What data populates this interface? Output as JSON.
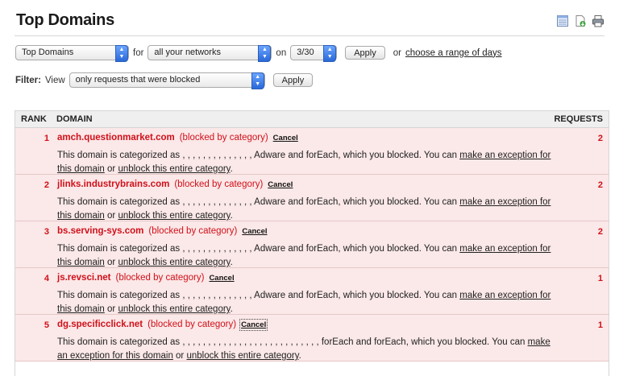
{
  "page": {
    "title": "Top Domains"
  },
  "header_icons": [
    "table-view-icon",
    "export-icon",
    "print-icon"
  ],
  "controls": {
    "report_select": "Top Domains",
    "for_label": "for",
    "network_select": "all your networks",
    "on_label": "on",
    "date_select": "3/30",
    "apply_label": "Apply",
    "or_label": "or",
    "range_link": "choose a range of days"
  },
  "filter": {
    "label": "Filter:",
    "view_label": "View",
    "select": "only requests that were blocked",
    "apply_label": "Apply"
  },
  "table": {
    "headers": {
      "rank": "RANK",
      "domain": "DOMAIN",
      "requests": "REQUESTS"
    },
    "rows": [
      {
        "rank": "1",
        "domain": "amch.questionmarket.com",
        "status": "(blocked by category)",
        "cancel": "Cancel",
        "desc_pre": "This domain is categorized as , , , , , , , , , , , , , , Adware and forEach, which you blocked.  You can ",
        "exception_link": "make an exception for this domain",
        "or": " or ",
        "unblock_link": "unblock this entire category",
        "end": ".",
        "requests": "2"
      },
      {
        "rank": "2",
        "domain": "jlinks.industrybrains.com",
        "status": "(blocked by category)",
        "cancel": "Cancel",
        "desc_pre": "This domain is categorized as , , , , , , , , , , , , , , Adware and forEach, which you blocked.  You can ",
        "exception_link": "make an exception for this domain",
        "or": " or ",
        "unblock_link": "unblock this entire category",
        "end": ".",
        "requests": "2"
      },
      {
        "rank": "3",
        "domain": "bs.serving-sys.com",
        "status": "(blocked by category)",
        "cancel": "Cancel",
        "desc_pre": "This domain is categorized as , , , , , , , , , , , , , , Adware and forEach, which you blocked.  You can ",
        "exception_link": "make an exception for this domain",
        "or": " or ",
        "unblock_link": "unblock this entire category",
        "end": ".",
        "requests": "2"
      },
      {
        "rank": "4",
        "domain": "js.revsci.net",
        "status": "(blocked by category)",
        "cancel": "Cancel",
        "desc_pre": "This domain is categorized as , , , , , , , , , , , , , , Adware and forEach, which you blocked.  You can ",
        "exception_link": "make an exception for this domain",
        "or": " or ",
        "unblock_link": "unblock this entire category",
        "end": ".",
        "requests": "1"
      },
      {
        "rank": "5",
        "domain": "dg.specificclick.net",
        "status": "(blocked by category)",
        "cancel": "Cancel",
        "desc_pre": "This domain is categorized as , , , , , , , , , , , , , , , , , , , , , , , , , , , forEach and forEach, which you blocked.  You can ",
        "exception_link": "make an exception for this domain",
        "or": " or ",
        "unblock_link": "unblock this entire category",
        "end": ".",
        "requests": "1"
      }
    ]
  },
  "colors": {
    "accent": "#d0101a",
    "row_bg": "#fbe8e8",
    "header_bg": "#efefef"
  }
}
